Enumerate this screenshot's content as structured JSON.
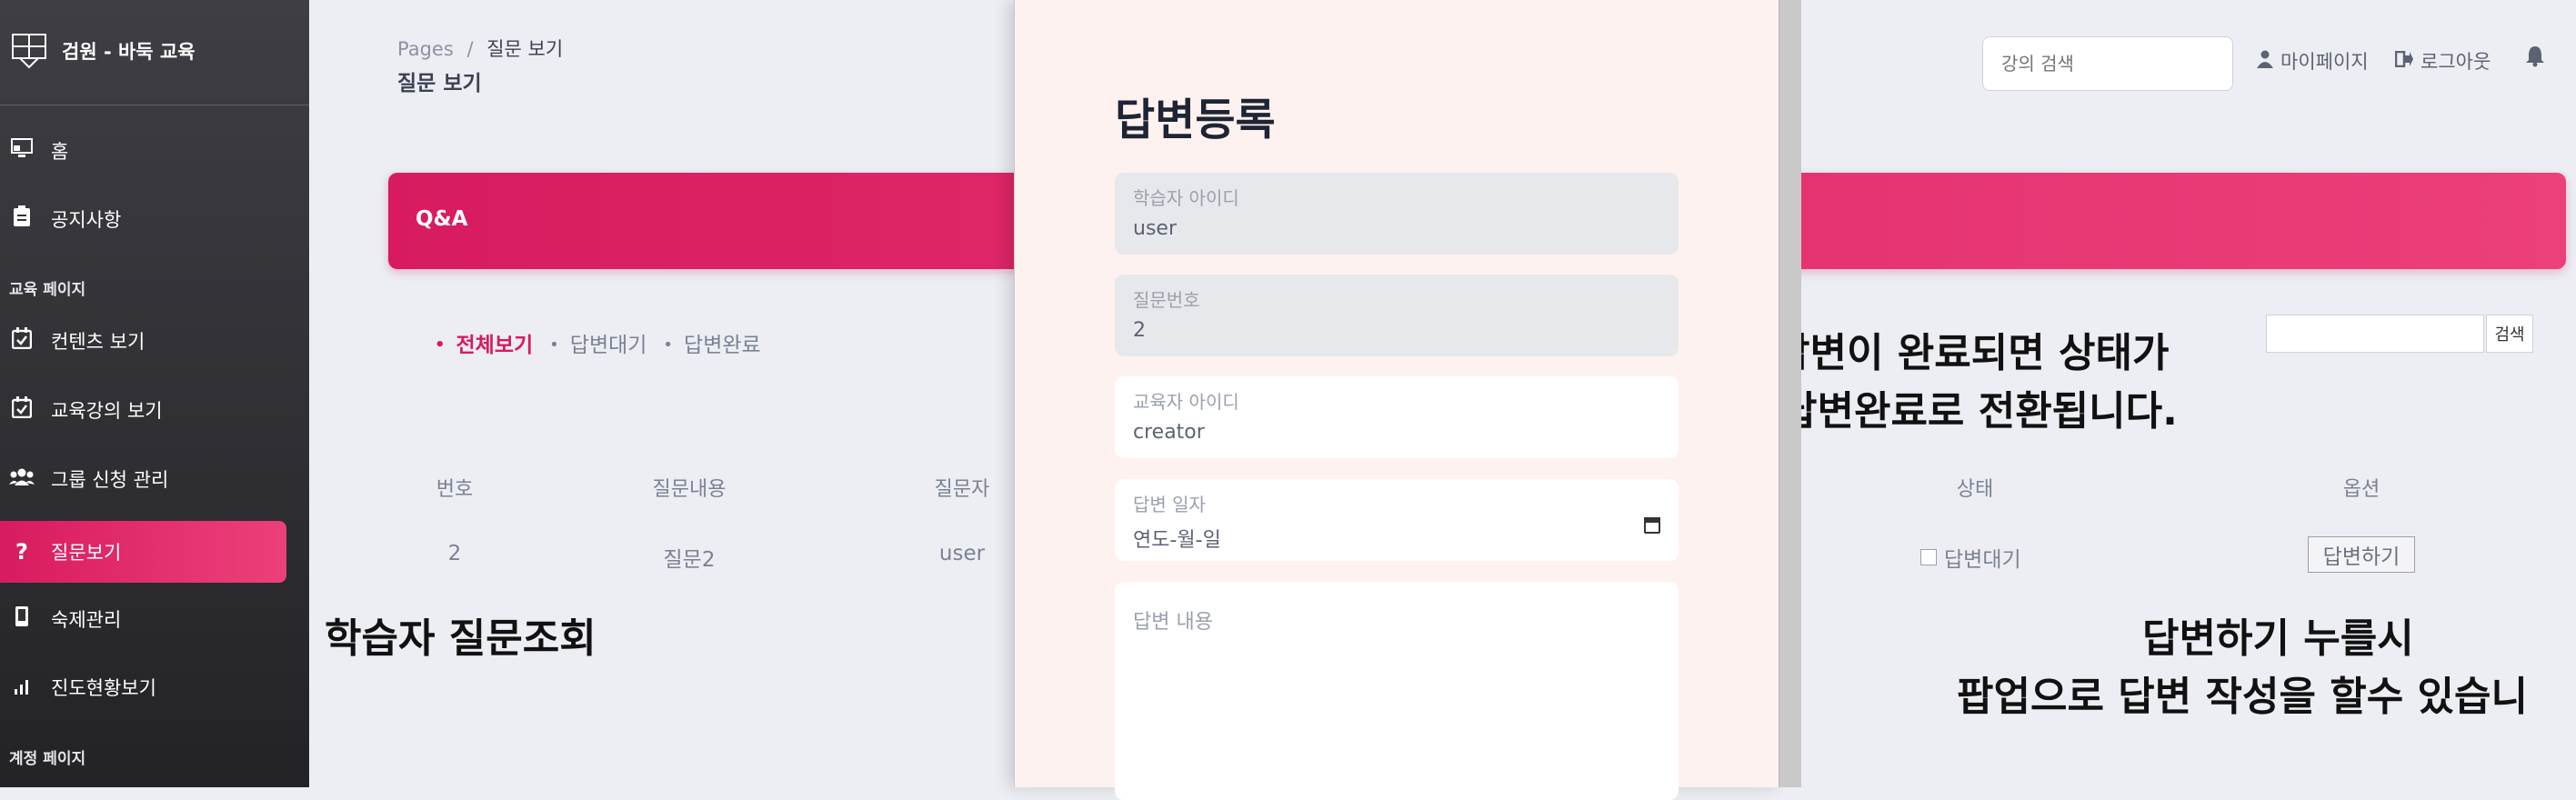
{
  "sidebar": {
    "brand": "검원 - 바둑 교육",
    "items": [
      {
        "label": "홈"
      },
      {
        "label": "공지사항"
      },
      {
        "label": "컨텐츠 보기"
      },
      {
        "label": "교육강의 보기"
      },
      {
        "label": "그룹 신청 관리"
      },
      {
        "label": "질문보기"
      },
      {
        "label": "숙제관리"
      },
      {
        "label": "진도현황보기"
      }
    ],
    "section_education": "교육 페이지",
    "section_account": "계정 페이지"
  },
  "header": {
    "breadcrumb_root": "Pages",
    "breadcrumb_sep": "/",
    "breadcrumb_current": "질문 보기",
    "title": "질문 보기",
    "search_placeholder": "강의 검색",
    "mypage": "마이페이지",
    "logout": "로그아웃"
  },
  "banner": {
    "title": "Q&A"
  },
  "filters": [
    {
      "label": "전체보기"
    },
    {
      "label": "답변대기"
    },
    {
      "label": "답변완료"
    }
  ],
  "table": {
    "headers": [
      "번호",
      "질문내용",
      "질문자",
      "상태",
      "옵션"
    ],
    "row": {
      "number": "2",
      "content": "질문2",
      "questioner": "user",
      "status": "답변대기",
      "option_button": "답변하기"
    }
  },
  "right_search": {
    "button": "검색"
  },
  "annotations": {
    "left": "학습자 질문조회",
    "status_line1": "답변이 완료되면 상태가",
    "status_line2": "답변완료로 전환됩니다.",
    "popup_line1": "답변하기 누를시",
    "popup_line2": "팝업으로 답변 작성을 할수 있습니"
  },
  "modal": {
    "title": "답변등록",
    "fields": [
      {
        "label": "학습자 아이디",
        "value": "user"
      },
      {
        "label": "질문번호",
        "value": "2"
      },
      {
        "label": "교육자 아이디",
        "value": "creator"
      },
      {
        "label": "답변 일자",
        "value": "연도-월-일"
      }
    ],
    "textarea_placeholder": "답변 내용"
  }
}
